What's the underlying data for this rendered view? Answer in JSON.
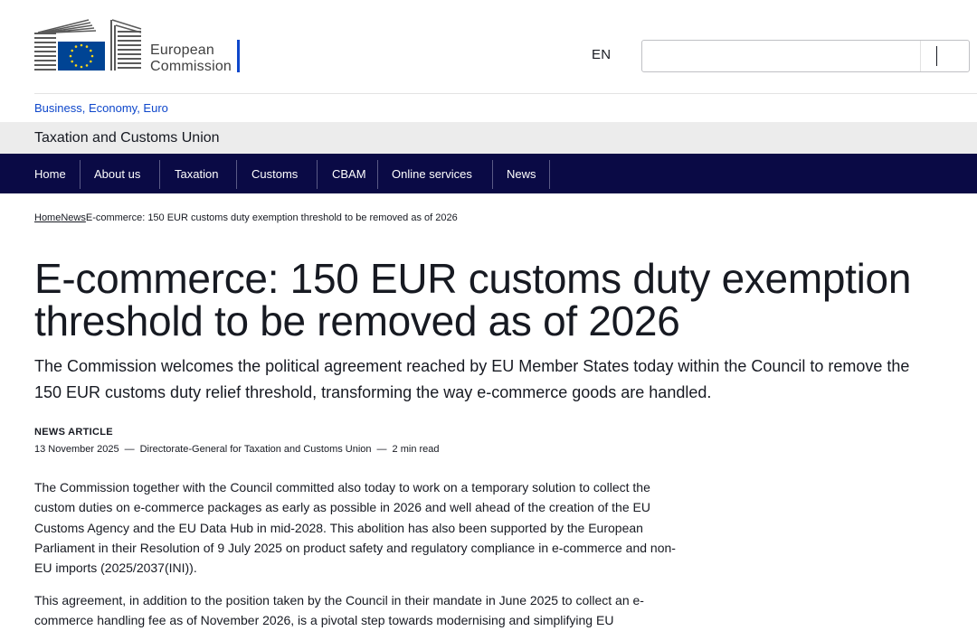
{
  "header": {
    "logo_line1": "European",
    "logo_line2": "Commission",
    "language": "EN",
    "search_value": ""
  },
  "site": {
    "parent_link": "Business, Economy, Euro",
    "title": "Taxation and Customs Union"
  },
  "nav": {
    "items": [
      "Home",
      "About us",
      "Taxation",
      "Customs",
      "CBAM",
      "Online services",
      "News"
    ]
  },
  "breadcrumb": {
    "home": "Home",
    "news": "News",
    "current": "E-commerce: 150 EUR customs duty exemption threshold to be removed as of 2026"
  },
  "article": {
    "title": "E-commerce: 150 EUR customs duty exemption threshold to be removed as of 2026",
    "lead": "The Commission welcomes the political agreement reached by EU Member States today within the Council to remove the 150 EUR customs duty relief threshold, transforming the way e-commerce goods are handled.",
    "type": "NEWS ARTICLE",
    "date": "13 November 2025",
    "author": "Directorate-General for Taxation and Customs Union",
    "read_time": "2 min read",
    "paragraph1": "The Commission together with the Council committed also today to work on a temporary solution to collect the custom duties on e-commerce packages as early as possible in 2026 and well ahead of the creation of the EU Customs Agency and the EU Data Hub in mid-2028. This abolition has also been supported by the European Parliament in their Resolution of 9 July 2025 on product safety and regulatory compliance in e-commerce and non-EU imports (2025/2037(INI)).",
    "paragraph2": "This agreement, in addition to the position taken by the Council in their mandate in June 2025 to collect an e-commerce handling fee as of November 2026, is a pivotal step towards modernising and simplifying EU"
  },
  "colors": {
    "nav_bg": "#0a0a45",
    "link": "#0e47cb",
    "band_bg": "#ececec",
    "logo_blue": "#004494",
    "logo_star": "#ffd617"
  }
}
